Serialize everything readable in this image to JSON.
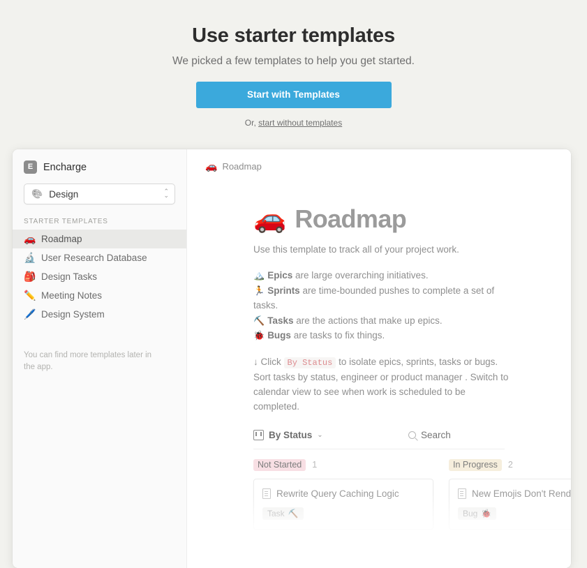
{
  "hero": {
    "title": "Use starter templates",
    "subtitle": "We picked a few templates to help you get started.",
    "cta_label": "Start with Templates",
    "alt_prefix": "Or, ",
    "alt_link": "start without templates"
  },
  "colors": {
    "page_background": "#f2f2ee",
    "cta_blue": "#3ba9dc",
    "sidebar_background": "#fafafa",
    "active_row": "#e9e9e7",
    "not_started_badge": "#f8dfe4",
    "in_progress_badge": "#f6eedd",
    "code_chip_text": "#dd8b8f"
  },
  "sidebar": {
    "brand_badge": "E",
    "brand_name": "Encharge",
    "workspace": {
      "icon": "palette-icon",
      "emoji": "🎨",
      "label": "Design"
    },
    "section_label": "STARTER TEMPLATES",
    "items": [
      {
        "emoji": "🚗",
        "icon": "car-icon",
        "label": "Roadmap",
        "active": true
      },
      {
        "emoji": "🔬",
        "icon": "microscope-icon",
        "label": "User Research Database",
        "active": false
      },
      {
        "emoji": "🎒",
        "icon": "backpack-icon",
        "label": "Design Tasks",
        "active": false
      },
      {
        "emoji": "✏️",
        "icon": "pencil-icon",
        "label": "Meeting Notes",
        "active": false
      },
      {
        "emoji": "🖊️",
        "icon": "pen-icon",
        "label": "Design System",
        "active": false
      }
    ],
    "footer_note": "You can find more templates later in the app."
  },
  "content": {
    "breadcrumb": {
      "emoji": "🚗",
      "label": "Roadmap"
    },
    "doc_title": {
      "emoji": "🚗",
      "text": "Roadmap"
    },
    "intro": "Use this template to track all of your project work.",
    "definitions": [
      {
        "emoji": "🏔️",
        "icon": "mountain-icon",
        "term": "Epics",
        "rest": " are large overarching initiatives."
      },
      {
        "emoji": "🏃",
        "icon": "runner-icon",
        "term": "Sprints",
        "rest": " are time-bounded pushes to complete a set of tasks."
      },
      {
        "emoji": "⛏️",
        "icon": "pick-icon",
        "term": "Tasks",
        "rest": " are the actions that make up epics."
      },
      {
        "emoji": "🐞",
        "icon": "ladybug-icon",
        "term": "Bugs",
        "rest": " are tasks to fix things."
      }
    ],
    "instructions": {
      "arrow": "↓",
      "before": " Click ",
      "code": "By Status",
      "after": " to isolate epics, sprints, tasks or bugs. Sort tasks by status, engineer or product manager . Switch to calendar view to see when work is scheduled to be completed."
    },
    "toolbar": {
      "view_label": "By Status",
      "chevron": "⌄",
      "search_placeholder": "Search"
    },
    "board": {
      "columns": [
        {
          "name": "Not Started",
          "count": "1",
          "badge_color": "#f8dfe4",
          "cards": [
            {
              "title": "Rewrite Query Caching Logic",
              "tag": "Task",
              "tag_emoji": "⛏️"
            }
          ]
        },
        {
          "name": "In Progress",
          "count": "2",
          "badge_color": "#f6eedd",
          "cards": [
            {
              "title": "New Emojis Don't Render",
              "tag": "Bug",
              "tag_emoji": "🐞"
            }
          ]
        }
      ]
    }
  }
}
